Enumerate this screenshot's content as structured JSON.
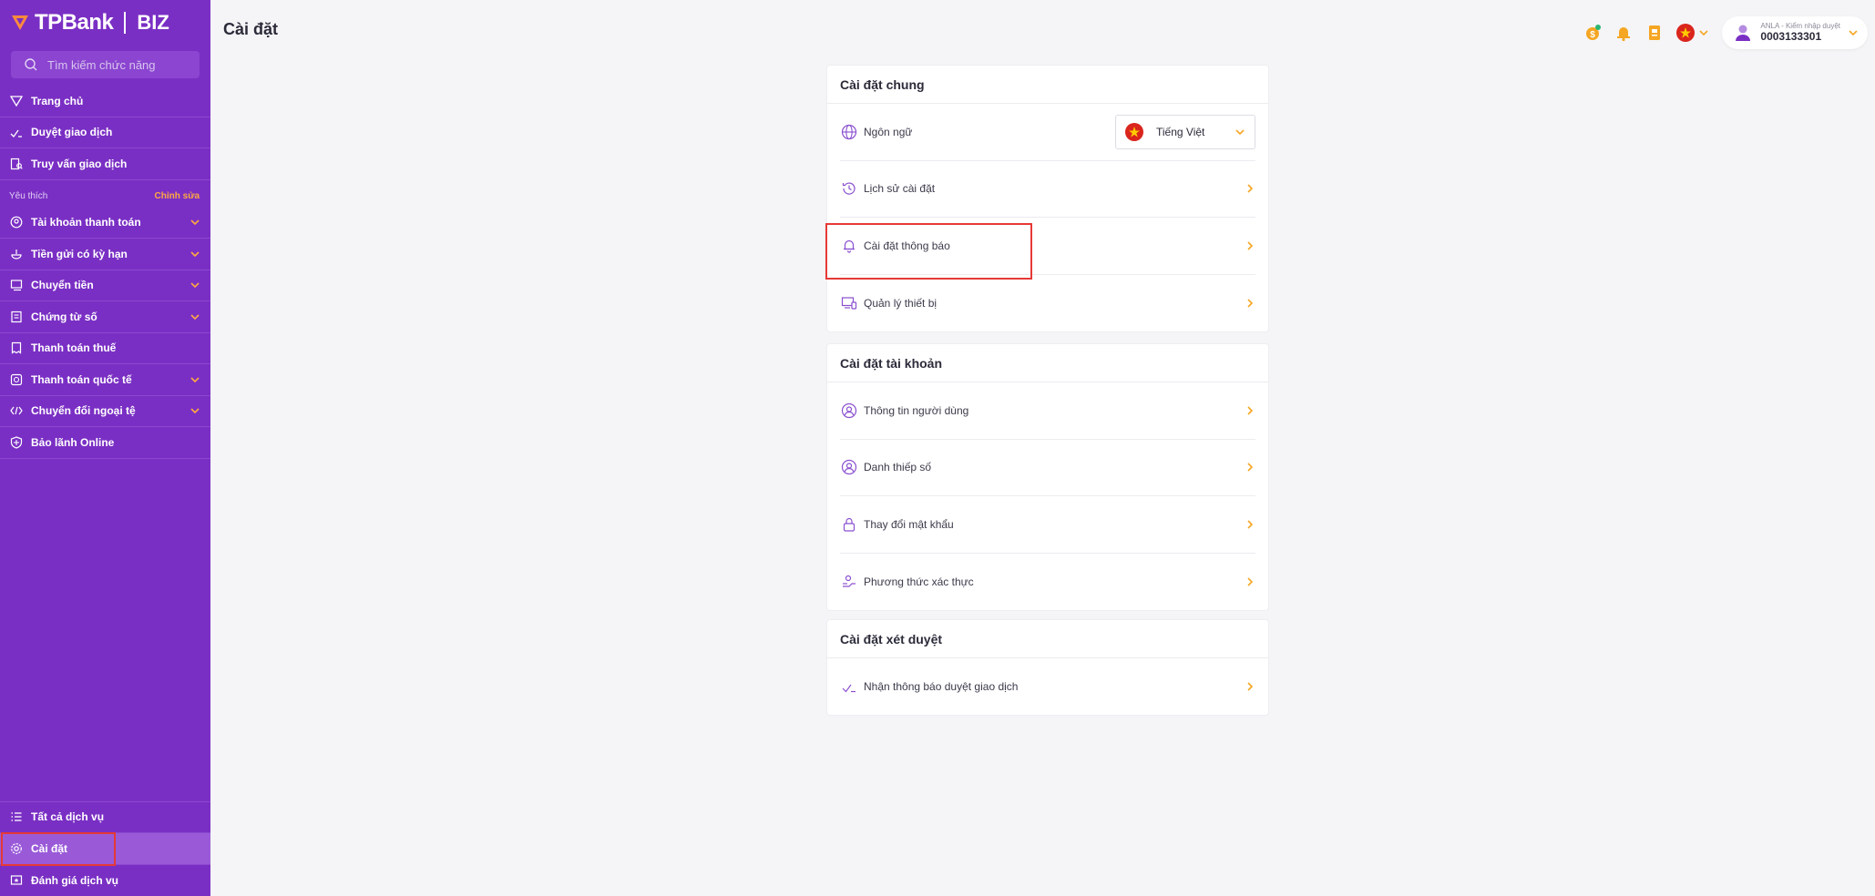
{
  "brand": {
    "name": "TPBank",
    "product": "BIZ"
  },
  "sidebar": {
    "search_placeholder": "Tìm kiếm chức năng",
    "top_items": [
      {
        "label": "Trang chủ"
      },
      {
        "label": "Duyệt giao dịch"
      },
      {
        "label": "Truy vấn giao dịch"
      }
    ],
    "favorites_title": "Yêu thích",
    "favorites_edit": "Chỉnh sửa",
    "fav_items": [
      {
        "label": "Tài khoản thanh toán"
      },
      {
        "label": "Tiền gửi có kỳ hạn"
      },
      {
        "label": "Chuyển tiền"
      },
      {
        "label": "Chứng từ số"
      },
      {
        "label": "Thanh toán thuế"
      },
      {
        "label": "Thanh toán quốc tế"
      },
      {
        "label": "Chuyển đổi ngoại tệ"
      },
      {
        "label": "Bảo lãnh Online"
      }
    ],
    "bottom_items": [
      {
        "label": "Tất cả dịch vụ"
      },
      {
        "label": "Cài đặt"
      },
      {
        "label": "Đánh giá dịch vụ"
      }
    ]
  },
  "header": {
    "title": "Cài đặt",
    "user_role": "ANLA - Kiểm nhập duyệt",
    "user_account": "0003133301"
  },
  "general": {
    "title": "Cài đặt chung",
    "language_label": "Ngôn ngữ",
    "language_value": "Tiếng Việt",
    "history": "Lịch sử cài đặt",
    "notifications": "Cài đặt thông báo",
    "devices": "Quản lý thiết bị"
  },
  "account": {
    "title": "Cài đặt tài khoản",
    "user_info": "Thông tin người dùng",
    "business_card": "Danh thiếp số",
    "change_password": "Thay đổi mật khẩu",
    "auth_method": "Phương thức xác thực"
  },
  "approval": {
    "title": "Cài đặt xét duyệt",
    "receive_notice": "Nhận thông báo duyệt giao dịch"
  },
  "colors": {
    "sidebar": "#7a2fc4",
    "accent": "#f5a623",
    "highlight": "#e53935",
    "flag_red": "#da251d",
    "flag_star": "#ffcd00"
  }
}
